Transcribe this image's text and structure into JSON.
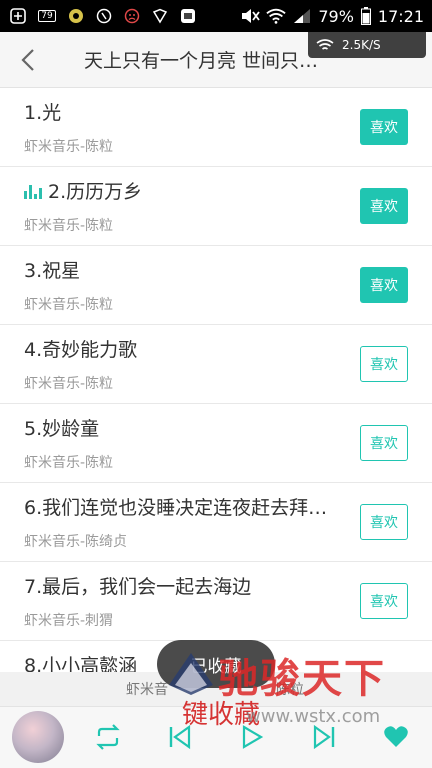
{
  "status_bar": {
    "battery": "79%",
    "time": "17:21",
    "left_badge": "79"
  },
  "header": {
    "title": "天上只有一个月亮 世间只…",
    "speed": "2.5K/S"
  },
  "songs": [
    {
      "title": "1.光",
      "artist": "虾米音乐-陈粒",
      "like_label": "喜欢",
      "liked": true,
      "playing": false
    },
    {
      "title": "2.历历万乡",
      "artist": "虾米音乐-陈粒",
      "like_label": "喜欢",
      "liked": true,
      "playing": true
    },
    {
      "title": "3.祝星",
      "artist": "虾米音乐-陈粒",
      "like_label": "喜欢",
      "liked": true,
      "playing": false
    },
    {
      "title": "4.奇妙能力歌",
      "artist": "虾米音乐-陈粒",
      "like_label": "喜欢",
      "liked": false,
      "playing": false
    },
    {
      "title": "5.妙龄童",
      "artist": "虾米音乐-陈粒",
      "like_label": "喜欢",
      "liked": false,
      "playing": false
    },
    {
      "title": "6.我们连觉也没睡决定连夜赶去拜…",
      "artist": "虾米音乐-陈绮贞",
      "like_label": "喜欢",
      "liked": false,
      "playing": false
    },
    {
      "title": "7.最后，我们会一起去海边",
      "artist": "虾米音乐-刺猬",
      "like_label": "喜欢",
      "liked": false,
      "playing": false
    },
    {
      "title": "8.小小高懿涵",
      "artist": "",
      "like_label": "",
      "liked": false,
      "playing": false
    }
  ],
  "toast": {
    "text": "已收藏"
  },
  "mini_player": {
    "artist_a": "虾米音",
    "artist_b": "陈粒"
  },
  "watermark": {
    "brand": "驰骏天下",
    "url": "www.wstx.com",
    "collect": "键收藏"
  },
  "colors": {
    "accent": "#20c5b1",
    "status_bar": "#000000",
    "header_bg": "#f6f6f6"
  },
  "icons": {
    "back": "chevron-left-icon",
    "repeat": "repeat-icon",
    "prev": "skip-previous-icon",
    "play": "play-icon",
    "next": "skip-next-icon",
    "favorite": "heart-icon"
  }
}
